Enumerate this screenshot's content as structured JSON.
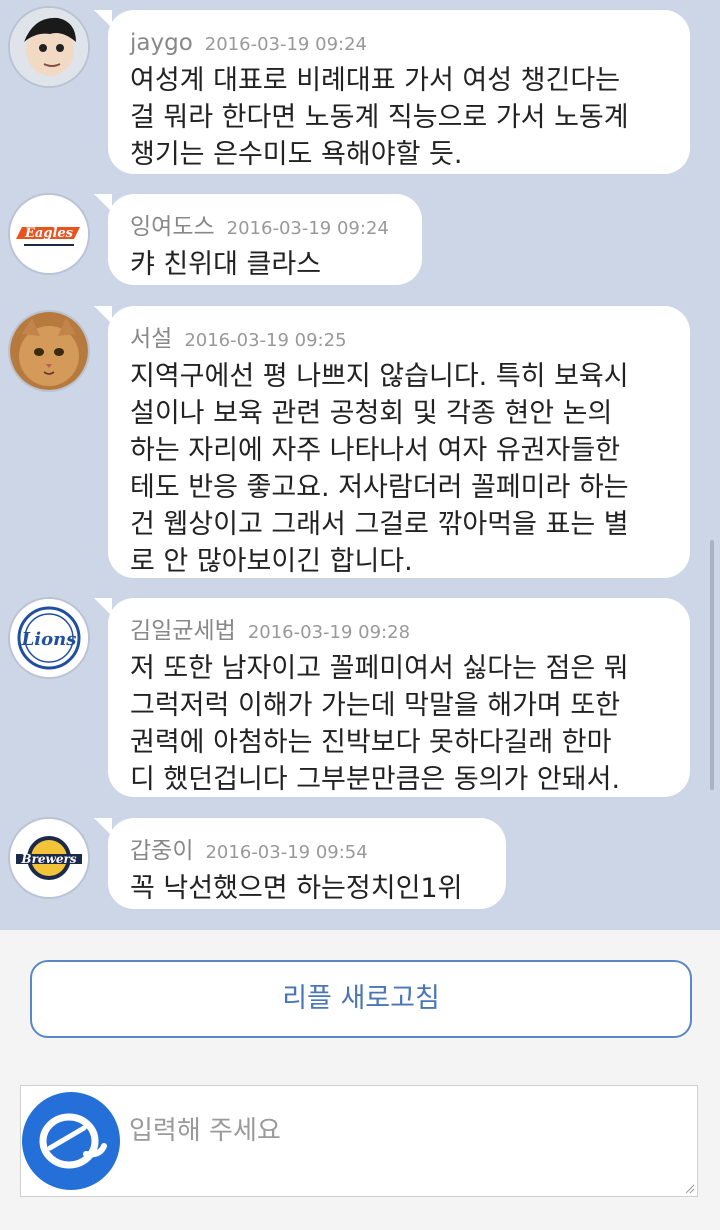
{
  "comments": [
    {
      "avatar": "robot-avatar-icon",
      "nickname": "jaygo",
      "time": "2016-03-19 09:24",
      "text": "여성계 대표로 비례대표 가서 여성 챙긴다는\n걸 뭐라 한다면 노동계 직능으로 가서 노동계\n챙기는 은수미도 욕해야할 듯."
    },
    {
      "avatar": "eagles-logo-icon",
      "avatar_text": "Eagles",
      "nickname": "잉여도스",
      "time": "2016-03-19 09:24",
      "text": "캬 친위대 클라스"
    },
    {
      "avatar": "cat-avatar-icon",
      "nickname": "서설",
      "time": "2016-03-19 09:25",
      "text": "지역구에선 평 나쁘지 않습니다. 특히 보육시\n설이나 보육 관련 공청회 및 각종 현안 논의\n하는 자리에 자주 나타나서 여자 유권자들한\n테도 반응 좋고요. 저사람더러 꼴페미라 하는\n건 웹상이고 그래서 그걸로 깎아먹을 표는 별\n로 안 많아보이긴 합니다."
    },
    {
      "avatar": "lions-logo-icon",
      "avatar_text": "Lions",
      "nickname": "김일균세법",
      "time": "2016-03-19 09:28",
      "text": "저 또한 남자이고 꼴페미여서 싫다는 점은 뭐\n그럭저럭 이해가 가는데 막말을 해가며 또한\n권력에 아첨하는 진박보다 못하다길래 한마\n디 했던겁니다 그부분만큼은 동의가 안돼서."
    },
    {
      "avatar": "brewers-logo-icon",
      "avatar_text": "Brewers",
      "nickname": "갑중이",
      "time": "2016-03-19 09:54",
      "text": "꼭 낙선했으면 하는정치인1위"
    }
  ],
  "refresh_label": "리플 새로고침",
  "input": {
    "placeholder": "입력해  주세요"
  },
  "colors": {
    "chat_background": "#cdd6e6",
    "bubble": "#ffffff",
    "accent": "#4a76b8",
    "logo_blue": "#2470d8"
  }
}
